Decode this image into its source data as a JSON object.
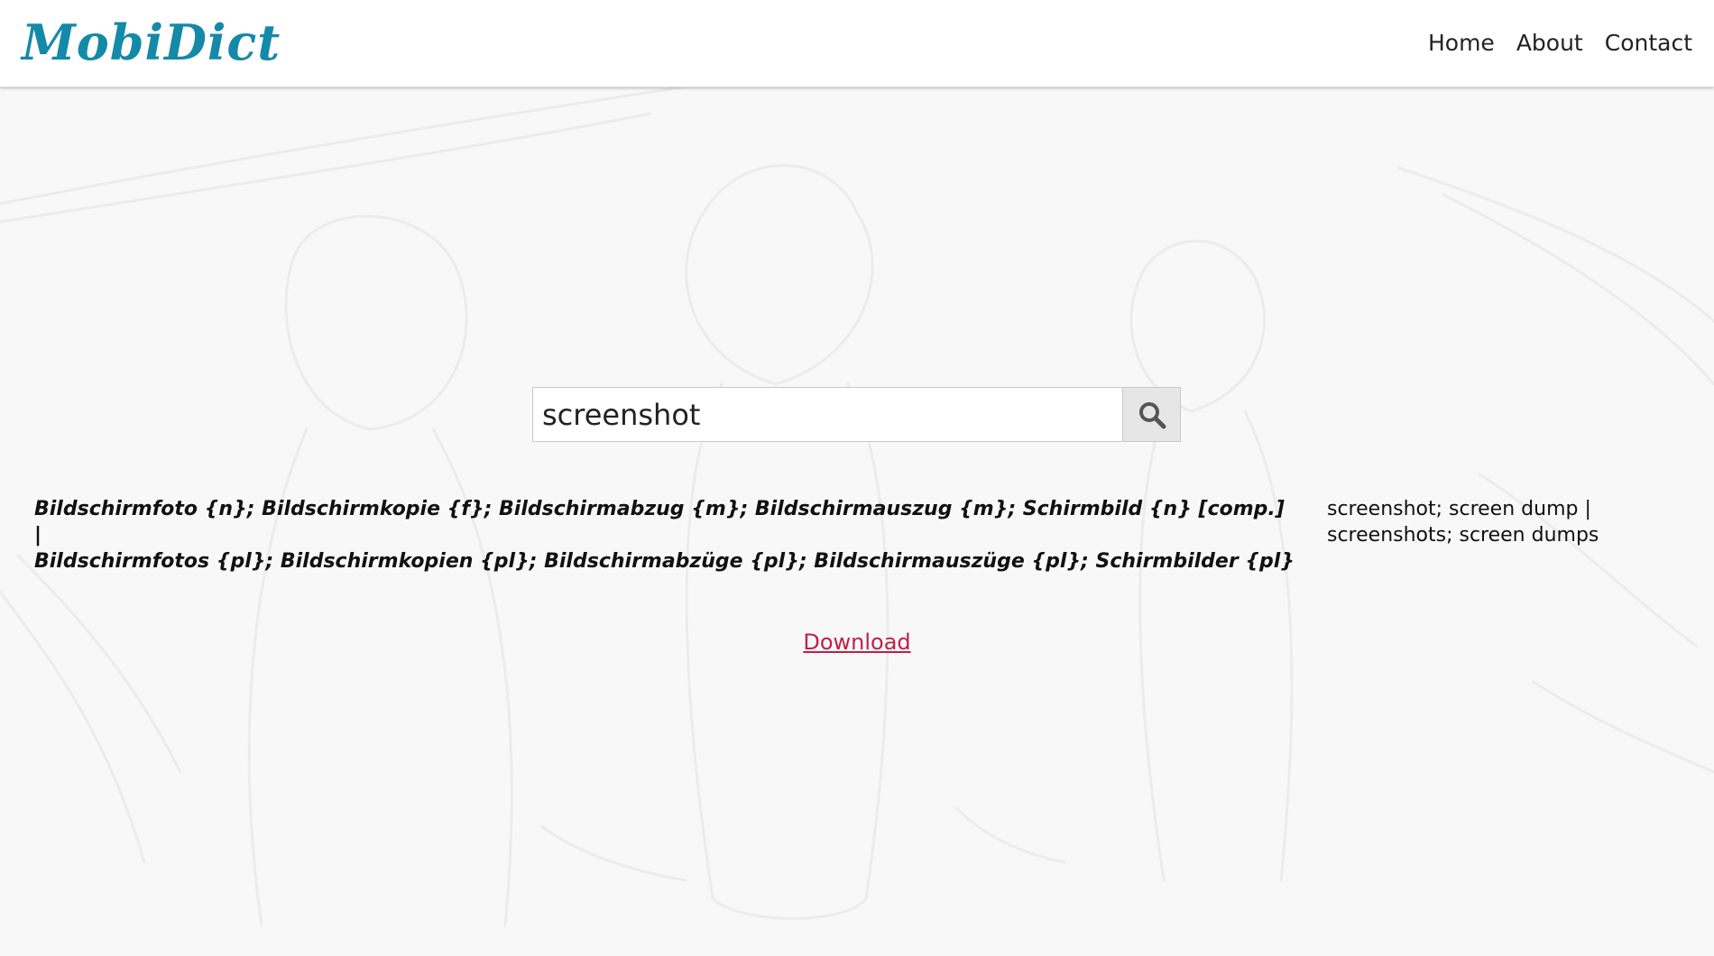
{
  "header": {
    "logo": "MobiDict",
    "nav": [
      {
        "label": "Home"
      },
      {
        "label": "About"
      },
      {
        "label": "Contact"
      }
    ]
  },
  "search": {
    "value": "screenshot",
    "button_icon": "search-icon"
  },
  "result": {
    "german_line1": "Bildschirmfoto {n}; Bildschirmkopie {f}; Bildschirmabzug {m}; Bildschirmauszug {m}; Schirmbild {n} [comp.] |",
    "german_line2": "Bildschirmfotos {pl}; Bildschirmkopien {pl}; Bildschirmabzüge {pl}; Bildschirmauszüge {pl}; Schirmbilder {pl}",
    "english_line1": "screenshot; screen dump |",
    "english_line2": "screenshots; screen dumps"
  },
  "download": {
    "label": "Download"
  },
  "colors": {
    "brand": "#1489a8",
    "link": "#c21f47",
    "background": "#f8f8f8"
  }
}
